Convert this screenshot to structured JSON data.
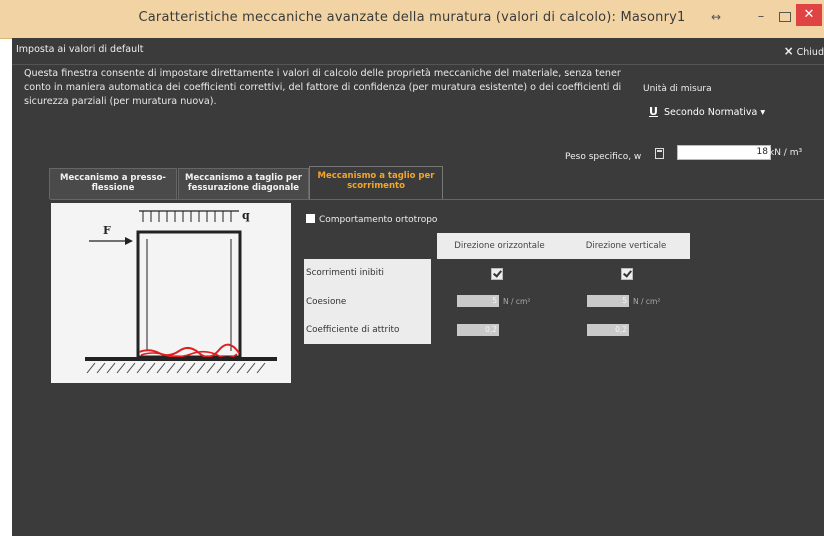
{
  "window": {
    "title": "Caratteristiche meccaniche avanzate della muratura (valori di calcolo): Masonry1"
  },
  "toolbar": {
    "reset_label": "Imposta ai valori di default",
    "close_label": "Chiud",
    "close_icon": "×"
  },
  "description": "Questa finestra consente di impostare direttamente i valori di calcolo delle proprietà meccaniche del materiale, senza tener conto in maniera automatica dei coefficienti correttivi, del fattore di confidenza (per muratura esistente) o dei coefficienti di sicurezza parziali (per muratura nuova).",
  "units": {
    "label": "Unità di misura",
    "icon": "U",
    "value": "Secondo Normativa"
  },
  "peso": {
    "label": "Peso specifico, w",
    "value": "18",
    "unit": "kN / m³"
  },
  "tabs": [
    {
      "label": "Meccanismo a presso-flessione"
    },
    {
      "label": "Meccanismo a taglio per fessurazione diagonale"
    },
    {
      "label": "Meccanismo a taglio per scorrimento"
    }
  ],
  "diagram": {
    "force_label": "F",
    "load_label": "q"
  },
  "orthotropic": {
    "label": "Comportamento ortotropo",
    "checked": false
  },
  "table": {
    "headers": [
      "Direzione orizzontale",
      "Direzione verticale"
    ],
    "rows": [
      {
        "label": "Scorrimenti inibiti",
        "h_checked": true,
        "v_checked": true
      },
      {
        "label": "Coesione",
        "h_value": "5",
        "v_value": "5",
        "unit": "N / cm²"
      },
      {
        "label": "Coefficiente di attrito",
        "h_value": "0,2",
        "v_value": "0,2"
      }
    ]
  },
  "colors": {
    "titlebar": "#f2d4a4",
    "body": "#3b3b3b",
    "active_tab": "#f5a623",
    "close_button": "#e04343"
  }
}
